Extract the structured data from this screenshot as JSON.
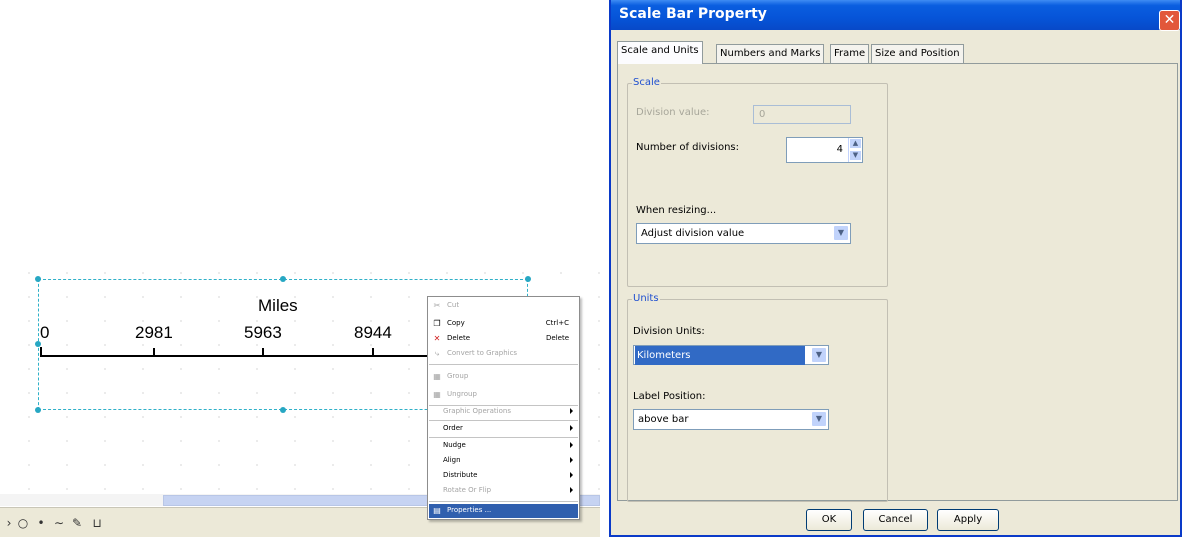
{
  "canvas": {
    "scalebar": {
      "title": "Miles",
      "labels": [
        "0",
        "2981",
        "5963",
        "8944"
      ]
    }
  },
  "context_menu": {
    "items": [
      {
        "label": "Cut",
        "shortcut": "",
        "enabled": false,
        "icon": "scissors-icon"
      },
      {
        "label": "Copy",
        "shortcut": "Ctrl+C",
        "enabled": true,
        "icon": "copy-icon"
      },
      {
        "label": "Delete",
        "shortcut": "Delete",
        "enabled": true,
        "icon": "delete-x-icon"
      },
      {
        "label": "Convert to Graphics",
        "shortcut": "",
        "enabled": false,
        "icon": "convert-icon"
      },
      {
        "label": "Group",
        "shortcut": "",
        "enabled": false,
        "icon": "group-icon"
      },
      {
        "label": "Ungroup",
        "shortcut": "",
        "enabled": false,
        "icon": "ungroup-icon"
      },
      {
        "label": "Graphic Operations",
        "shortcut": "",
        "enabled": false,
        "submenu": true
      },
      {
        "label": "Order",
        "shortcut": "",
        "enabled": true,
        "submenu": true
      },
      {
        "label": "Nudge",
        "shortcut": "",
        "enabled": true,
        "submenu": true
      },
      {
        "label": "Align",
        "shortcut": "",
        "enabled": true,
        "submenu": true
      },
      {
        "label": "Distribute",
        "shortcut": "",
        "enabled": true,
        "submenu": true
      },
      {
        "label": "Rotate Or Flip",
        "shortcut": "",
        "enabled": false,
        "submenu": true
      },
      {
        "label": "Properties ...",
        "shortcut": "",
        "enabled": true,
        "highlighted": true,
        "icon": "properties-icon"
      }
    ]
  },
  "dialog": {
    "title": "Scale Bar Property",
    "close_glyph": "✕",
    "tabs": [
      {
        "label": "Scale and Units",
        "active": true
      },
      {
        "label": "Numbers and Marks",
        "active": false
      },
      {
        "label": "Frame",
        "active": false
      },
      {
        "label": "Size and Position",
        "active": false
      }
    ],
    "scale_group": {
      "legend": "Scale",
      "division_value_label": "Division value:",
      "division_value": "0",
      "num_divisions_label": "Number of divisions:",
      "num_divisions": "4",
      "when_resizing_label": "When resizing...",
      "when_resizing_value": "Adjust division value"
    },
    "units_group": {
      "legend": "Units",
      "division_units_label": "Division Units:",
      "division_units_value": "Kilometers",
      "label_position_label": "Label Position:",
      "label_position_value": "above bar"
    },
    "buttons": {
      "ok": "OK",
      "cancel": "Cancel",
      "apply": "Apply"
    }
  },
  "colors": {
    "titlebar": "#0654d8",
    "selection_frame": "#2fb0c8",
    "menu_highlight": "#305fae",
    "group_legend": "#2050d0"
  }
}
